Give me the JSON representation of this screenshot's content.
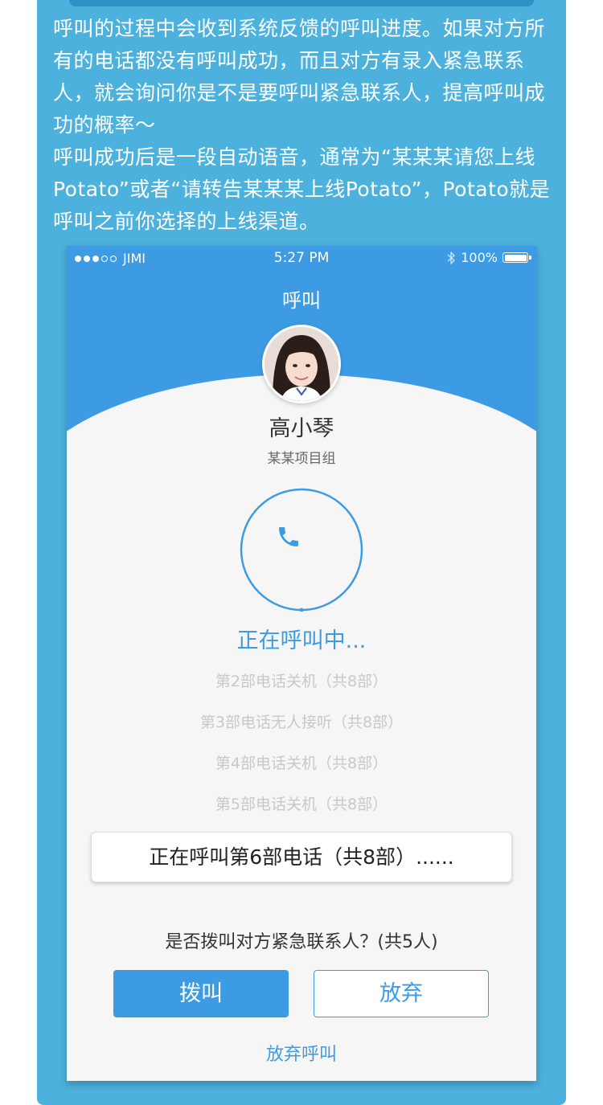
{
  "description": {
    "lines": [
      "呼叫的过程中会收到系统反馈的呼叫进度。如果对方所有的电话都没有呼叫成功，而且对方有录入紧急联系人，就会询问你是不是要呼叫紧急联系人，提高呼叫成功的概率～",
      "呼叫成功后是一段自动语音，通常为“某某某请您上线Potato”或者“请转告某某某上线Potato”，Potato就是呼叫之前你选择的上线渠道。"
    ]
  },
  "statusbar": {
    "carrier": "JIMI",
    "time": "5:27 PM",
    "battery": "100%",
    "signal_icon": "signal-dots-icon",
    "bluetooth_icon": "bluetooth-icon",
    "battery_icon": "battery-icon"
  },
  "nav": {
    "title": "呼叫"
  },
  "contact": {
    "name": "高小琴",
    "group": "某某项目组"
  },
  "call": {
    "status": "正在呼叫中...",
    "icon": "phone-icon",
    "history": [
      "第2部电话关机（共8部）",
      "第3部电话无人接听（共8部）",
      "第4部电话关机（共8部）",
      "第5部电话关机（共8部）"
    ],
    "current": "正在呼叫第6部电话（共8部）......"
  },
  "emergency": {
    "prompt": "是否拨叫对方紧急联系人？(共5人)",
    "dial_label": "拨叫",
    "giveup_label": "放弃",
    "abort_label": "放弃呼叫"
  },
  "colors": {
    "card_bg": "#4cb2dd",
    "accent": "#3d9be3",
    "page_bg": "#f6f6f6"
  }
}
